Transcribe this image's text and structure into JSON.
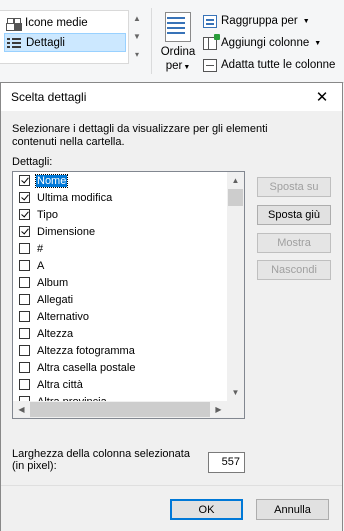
{
  "ribbon": {
    "layout_items": [
      {
        "label": "Icone medie",
        "icon": "medium-icons-icon",
        "selected": false
      },
      {
        "label": "Dettagli",
        "icon": "details-view-icon",
        "selected": true
      }
    ],
    "sort_by": {
      "line1": "Ordina",
      "line2": "per"
    },
    "actions": [
      {
        "label": "Raggruppa per",
        "icon": "group-by-icon",
        "dropdown": true
      },
      {
        "label": "Aggiungi colonne",
        "icon": "add-columns-icon",
        "dropdown": true
      },
      {
        "label": "Adatta tutte le colonne",
        "icon": "fit-columns-icon",
        "dropdown": false
      }
    ]
  },
  "dialog": {
    "title": "Scelta dettagli",
    "description": "Selezionare i dettagli da visualizzare per gli elementi contenuti nella cartella.",
    "details_label": "Dettagli:",
    "items": [
      {
        "label": "Nome",
        "checked": true,
        "selected": true
      },
      {
        "label": "Ultima modifica",
        "checked": true,
        "selected": false
      },
      {
        "label": "Tipo",
        "checked": true,
        "selected": false
      },
      {
        "label": "Dimensione",
        "checked": true,
        "selected": false
      },
      {
        "label": "#",
        "checked": false,
        "selected": false
      },
      {
        "label": "A",
        "checked": false,
        "selected": false
      },
      {
        "label": "Album",
        "checked": false,
        "selected": false
      },
      {
        "label": "Allegati",
        "checked": false,
        "selected": false
      },
      {
        "label": "Alternativo",
        "checked": false,
        "selected": false
      },
      {
        "label": "Altezza",
        "checked": false,
        "selected": false
      },
      {
        "label": "Altezza fotogramma",
        "checked": false,
        "selected": false
      },
      {
        "label": "Altra casella postale",
        "checked": false,
        "selected": false
      },
      {
        "label": "Altra città",
        "checked": false,
        "selected": false
      },
      {
        "label": "Altra provincia",
        "checked": false,
        "selected": false
      }
    ],
    "buttons": {
      "move_up": "Sposta su",
      "move_down": "Sposta giù",
      "show": "Mostra",
      "hide": "Nascondi",
      "ok": "OK",
      "cancel": "Annulla"
    },
    "width_label": "Larghezza della colonna selezionata (in pixel):",
    "width_value": "557"
  },
  "colors": {
    "selection": "#0078d7",
    "ribbon_selection": "#cce8ff",
    "accent": "#3873b8"
  }
}
